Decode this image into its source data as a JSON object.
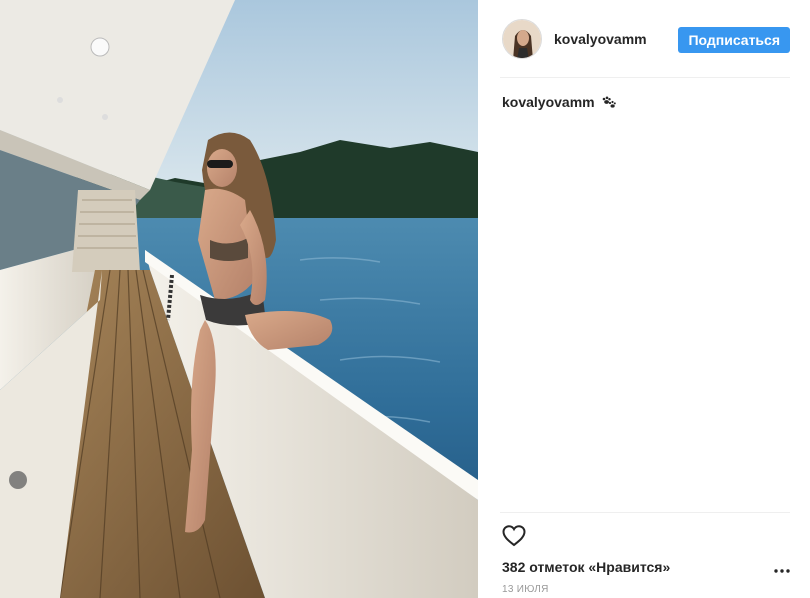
{
  "post": {
    "username": "kovalyovamm",
    "follow_label": "Подписаться",
    "caption_username": "kovalyovamm",
    "likes_text": "382 отметок «Нравится»",
    "date_text": "13 ИЮЛЯ"
  },
  "icons": {
    "caption_emoji": "paw-prints-icon",
    "like": "heart-outline-icon",
    "more": "more-options-icon"
  },
  "colors": {
    "accent": "#3897f0",
    "text": "#262626",
    "muted": "#999999",
    "divider": "#efefef"
  }
}
